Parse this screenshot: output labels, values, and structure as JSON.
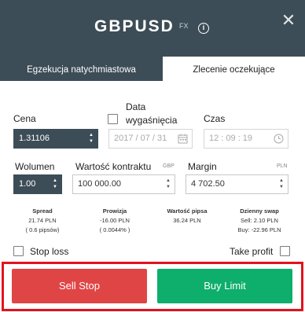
{
  "header": {
    "title": "GBPUSD",
    "badge": "FX"
  },
  "tabs": [
    {
      "label": "Egzekucja natychmiastowa",
      "active": false
    },
    {
      "label": "Zlecenie oczekujące",
      "active": true
    }
  ],
  "form": {
    "price_label": "Cena",
    "price_value": "1.31106",
    "expiry_label_1": "Data",
    "expiry_label_2": "wygaśnięcia",
    "expiry_date": "2017 / 07 / 31",
    "time_label": "Czas",
    "time_value": "12 : 09 : 19",
    "volume_label": "Wolumen",
    "volume_value": "1.00",
    "contract_label": "Wartość kontraktu",
    "contract_currency": "GBP",
    "contract_value": "100 000.00",
    "margin_label": "Margin",
    "margin_currency": "PLN",
    "margin_value": "4 702.50"
  },
  "stats": {
    "spread": {
      "title": "Spread",
      "line1": "21.74 PLN",
      "line2": "( 0.6 pipsów)"
    },
    "commission": {
      "title": "Prowizja",
      "line1": "-16.00 PLN",
      "line2": "( 0.0044% )"
    },
    "pip_value": {
      "title": "Wartość pipsa",
      "line1": "36.24 PLN"
    },
    "swap": {
      "title": "Dzienny swap",
      "line1": "Sell: 2.10 PLN",
      "line2": "Buy: -22.96 PLN"
    }
  },
  "options": {
    "stop_loss_label": "Stop loss",
    "take_profit_label": "Take profit"
  },
  "actions": {
    "sell_label": "Sell Stop",
    "buy_label": "Buy Limit"
  },
  "colors": {
    "header_bg": "#3d4d57",
    "sell": "#e04546",
    "buy": "#0eae6c",
    "highlight": "#e3121e"
  }
}
